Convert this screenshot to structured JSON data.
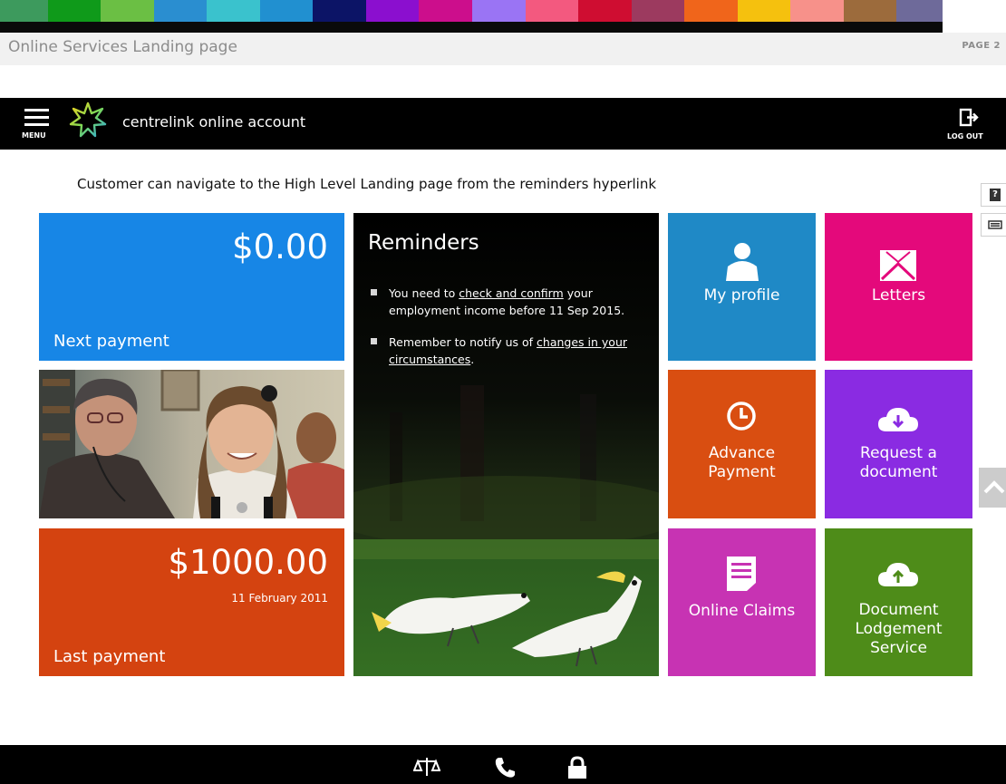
{
  "colors": {
    "stripe": [
      "#3d9a5d",
      "#0f9a1a",
      "#6bbf44",
      "#2a8ed0",
      "#3ac2cd",
      "#2190d0",
      "#0c1466",
      "#8b0fcf",
      "#cc0e8c",
      "#9a74f4",
      "#f3597f",
      "#cf0d31",
      "#9c3a5f",
      "#f0651b",
      "#f5c10e",
      "#f7918a",
      "#9c6b3c",
      "#6e6a9a"
    ],
    "next_payment_bg": "#1786e6",
    "last_payment_bg": "#d44310",
    "profile_bg": "#1f89c6",
    "letters_bg": "#e4097b",
    "advance_bg": "#d94e11",
    "request_bg": "#8a2be2",
    "claims_bg": "#c733b3",
    "lodgement_bg": "#4e8c19"
  },
  "doc": {
    "title": "Online Services Landing page",
    "page": "PAGE 2"
  },
  "header": {
    "menu_label": "MENU",
    "menu_icon": "hamburger-icon",
    "logo_icon": "star-logo-icon",
    "app_title": "centrelink online account",
    "logout_label": "LOG OUT",
    "logout_icon": "logout-icon"
  },
  "caption": "Customer can navigate to the High Level Landing page from the reminders hyperlink",
  "side_buttons": [
    {
      "name": "help-icon",
      "glyph": "?"
    },
    {
      "name": "keyboard-icon",
      "glyph": ""
    }
  ],
  "next_payment": {
    "amount": "$0.00",
    "label": "Next payment"
  },
  "last_payment": {
    "amount": "$1000.00",
    "date": "11 February 2011",
    "label": "Last payment"
  },
  "reminders": {
    "title": "Reminders",
    "item1": {
      "pre": "You need to ",
      "link": "check and confirm",
      "post": " your employment income before 11 Sep 2015."
    },
    "item2": {
      "pre": "Remember to notify us of ",
      "link": "changes in your circumstances",
      "post": "."
    }
  },
  "tiles": {
    "profile": {
      "label": "My profile",
      "icon": "person-icon"
    },
    "letters": {
      "label": "Letters",
      "icon": "envelope-icon"
    },
    "advance": {
      "line1": "Advance",
      "line2": "Payment",
      "icon": "clock-icon"
    },
    "request": {
      "line1": "Request a",
      "line2": "document",
      "icon": "cloud-download-icon"
    },
    "claims": {
      "label": "Online Claims",
      "icon": "document-icon"
    },
    "lodgement": {
      "line1": "Document",
      "line2": "Lodgement",
      "line3": "Service",
      "icon": "cloud-upload-icon"
    }
  },
  "footer_icons": [
    "scales-icon",
    "phone-icon",
    "lock-icon"
  ]
}
